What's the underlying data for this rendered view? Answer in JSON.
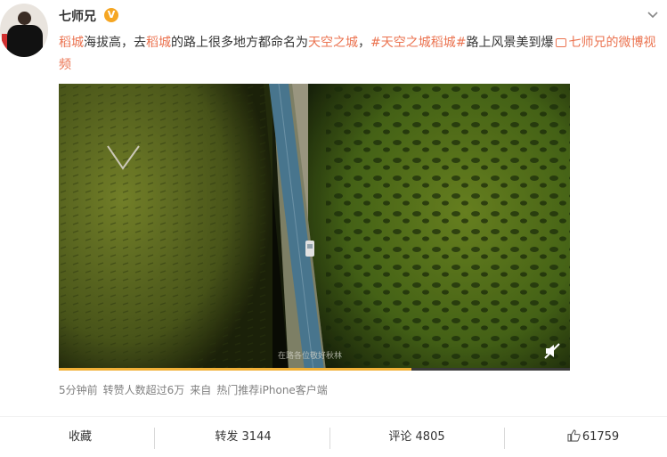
{
  "user": {
    "name": "七师兄",
    "badge": "V"
  },
  "post": {
    "t1": "稻城",
    "t2": "海拔高，去",
    "t3": "稻城",
    "t4": "的路上很多地方都命名为",
    "t5": "天空之城",
    "t6": "，",
    "t7": "#天空之城稻城#",
    "t8": "路上风景美到爆",
    "video_link": "七师兄的微博视频"
  },
  "video": {
    "subtitle": "在路各位敬好秋林",
    "progress": 0.69
  },
  "meta": {
    "time": "5分钟前",
    "reposts_info": "转赞人数超过6万",
    "source_prefix": "来自",
    "source": "热门推荐iPhone客户端"
  },
  "actions": {
    "favorite": "收藏",
    "repost": "转发 3144",
    "comment": "评论 4805",
    "like": "61759"
  }
}
